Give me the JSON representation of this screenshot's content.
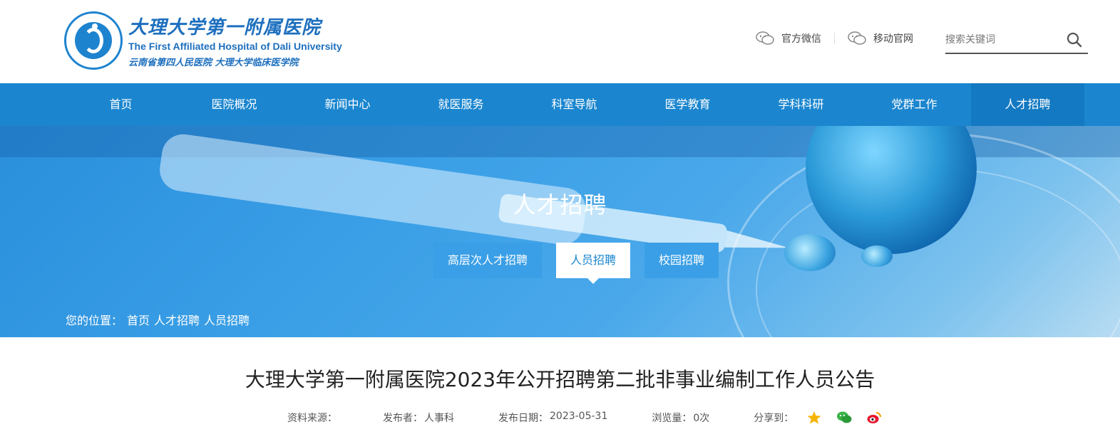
{
  "logo": {
    "cn": "大理大学第一附属医院",
    "en": "The First Affiliated Hospital of Dali University",
    "sub": "云南省第四人民医院  大理大学临床医学院"
  },
  "top_links": [
    {
      "label": "官方微信",
      "icon": "wechat-icon"
    },
    {
      "label": "移动官网",
      "icon": "mobile-chat-icon"
    }
  ],
  "search": {
    "placeholder": "搜索关键词",
    "icon": "search-icon"
  },
  "nav": {
    "items": [
      {
        "label": "首页"
      },
      {
        "label": "医院概况"
      },
      {
        "label": "新闻中心"
      },
      {
        "label": "就医服务"
      },
      {
        "label": "科室导航"
      },
      {
        "label": "医学教育"
      },
      {
        "label": "学科科研"
      },
      {
        "label": "党群工作"
      },
      {
        "label": "人才招聘"
      }
    ],
    "active_index": 8
  },
  "banner": {
    "title": "人才招聘",
    "subtabs": [
      {
        "label": "高层次人才招聘"
      },
      {
        "label": "人员招聘"
      },
      {
        "label": "校园招聘"
      }
    ],
    "active_subtab": 1,
    "breadcrumb": {
      "prefix": "您的位置：",
      "items": [
        "首页",
        "人才招聘",
        "人员招聘"
      ]
    }
  },
  "article": {
    "title": "大理大学第一附属医院2023年公开招聘第二批非事业编制工作人员公告",
    "meta": {
      "source_label": "资料来源：",
      "source_value": "",
      "publisher_label": "发布者：",
      "publisher_value": "人事科",
      "date_label": "发布日期：",
      "date_value": "2023-05-31",
      "views_label": "浏览量：",
      "views_value": "0次",
      "share_label": "分享到："
    },
    "share_icons": [
      "qzone-star-icon",
      "wechat-share-icon",
      "weibo-icon"
    ]
  },
  "colors": {
    "brand_blue": "#1b86cf",
    "nav_active": "#1379c2",
    "text_dark": "#222222"
  }
}
